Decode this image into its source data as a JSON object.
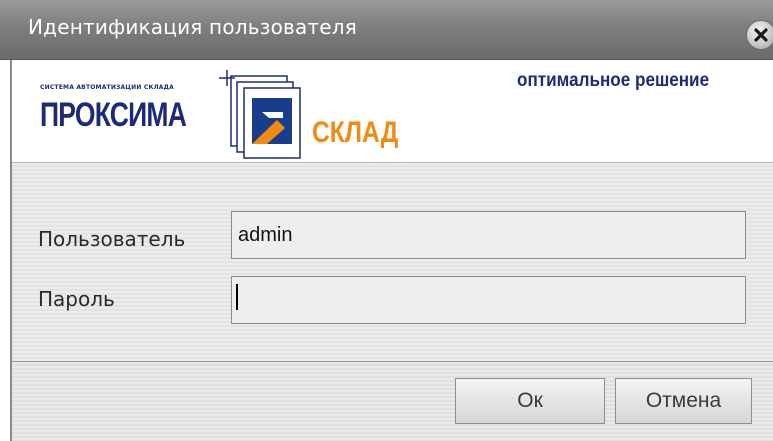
{
  "window": {
    "title": "Идентификация пользователя"
  },
  "banner": {
    "small_caption": "СИСТЕМА АВТОМАТИЗАЦИИ СКЛАДА",
    "brand_main": "ПРОКСИМА",
    "brand_sub": "СКЛАД",
    "tagline": "оптимальное решение",
    "colors": {
      "brand_blue": "#1d2a78",
      "brand_orange": "#f08a10"
    }
  },
  "form": {
    "user_label": "Пользователь",
    "user_value": "admin",
    "password_label": "Пароль",
    "password_value": ""
  },
  "buttons": {
    "ok": "Ок",
    "cancel": "Отмена"
  },
  "icons": {
    "close": "close-icon",
    "logo": "proksima-logo-mark"
  }
}
